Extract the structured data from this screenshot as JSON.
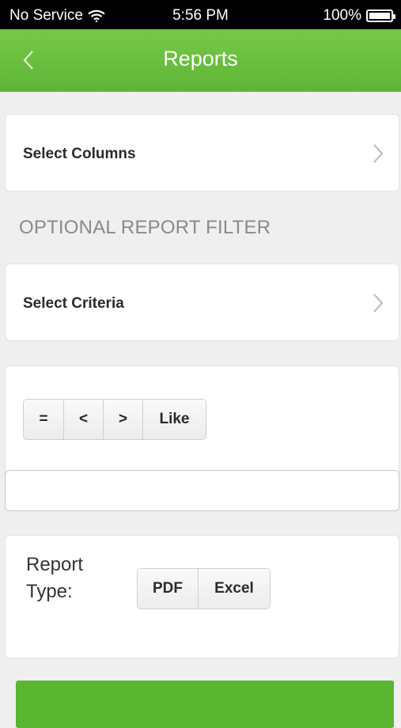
{
  "status_bar": {
    "carrier": "No Service",
    "time": "5:56 PM",
    "battery": "100%"
  },
  "nav": {
    "title": "Reports"
  },
  "select_columns": {
    "label": "Select Columns"
  },
  "filter_section": {
    "title": "OPTIONAL REPORT FILTER",
    "select_criteria_label": "Select Criteria",
    "operators": [
      "=",
      "<",
      ">",
      "Like"
    ],
    "value_input": ""
  },
  "report_type": {
    "label": "Report Type:",
    "options": [
      "PDF",
      "Excel"
    ]
  },
  "colors": {
    "accent": "#66bb3a",
    "background": "#efefef"
  }
}
